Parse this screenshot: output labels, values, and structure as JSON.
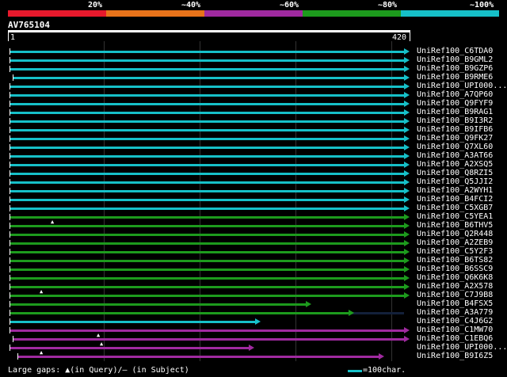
{
  "legend": {
    "labels": [
      "20%",
      "~40%",
      "~60%",
      "~80%",
      "~100%"
    ],
    "colors": [
      "#e8192c",
      "#e8731a",
      "#a02aa0",
      "#1d9b1d",
      "#16c0c8"
    ]
  },
  "query": {
    "name": "AV765104",
    "start": "1",
    "end": "420"
  },
  "hits": [
    {
      "label": "UniRef100_C6TDA0",
      "color": "#16c0c8"
    },
    {
      "label": "UniRef100_B9GML2",
      "color": "#16c0c8"
    },
    {
      "label": "UniRef100_B9GZP6",
      "color": "#16c0c8"
    },
    {
      "label": "UniRef100_B9RME6",
      "color": "#16c0c8"
    },
    {
      "label": "UniRef100_UPI000...",
      "color": "#16c0c8"
    },
    {
      "label": "UniRef100_A7QP60",
      "color": "#16c0c8"
    },
    {
      "label": "UniRef100_Q9FYF9",
      "color": "#16c0c8"
    },
    {
      "label": "UniRef100_B9RAG1",
      "color": "#16c0c8"
    },
    {
      "label": "UniRef100_B9I3R2",
      "color": "#16c0c8"
    },
    {
      "label": "UniRef100_B9IFB6",
      "color": "#16c0c8"
    },
    {
      "label": "UniRef100_Q9FK27",
      "color": "#16c0c8"
    },
    {
      "label": "UniRef100_Q7XL60",
      "color": "#16c0c8"
    },
    {
      "label": "UniRef100_A3AT66",
      "color": "#16c0c8"
    },
    {
      "label": "UniRef100_A2XSQ5",
      "color": "#16c0c8"
    },
    {
      "label": "UniRef100_Q8RZI5",
      "color": "#16c0c8"
    },
    {
      "label": "UniRef100_Q5JJI2",
      "color": "#16c0c8"
    },
    {
      "label": "UniRef100_A2WYH1",
      "color": "#16c0c8"
    },
    {
      "label": "UniRef100_B4FCI2",
      "color": "#16c0c8"
    },
    {
      "label": "UniRef100_C5XGB7",
      "color": "#16c0c8"
    },
    {
      "label": "UniRef100_C5YEA1",
      "color": "#1d9b1d"
    },
    {
      "label": "UniRef100_B6THV5",
      "color": "#1d9b1d"
    },
    {
      "label": "UniRef100_Q2R448",
      "color": "#1d9b1d"
    },
    {
      "label": "UniRef100_A2ZEB9",
      "color": "#1d9b1d"
    },
    {
      "label": "UniRef100_C5Y2F3",
      "color": "#1d9b1d"
    },
    {
      "label": "UniRef100_B6TS82",
      "color": "#1d9b1d"
    },
    {
      "label": "UniRef100_B6SSC9",
      "color": "#1d9b1d"
    },
    {
      "label": "UniRef100_Q6K6K8",
      "color": "#1d9b1d"
    },
    {
      "label": "UniRef100_A2X578",
      "color": "#1d9b1d"
    },
    {
      "label": "UniRef100_C7J9B8",
      "color": "#1d9b1d"
    },
    {
      "label": "UniRef100_B4FSX5",
      "color": "#1d9b1d"
    },
    {
      "label": "UniRef100_A3A779",
      "color": "#1d9b1d"
    },
    {
      "label": "UniRef100_C4J6G2",
      "color": "#16c0c8"
    },
    {
      "label": "UniRef100_C1MW70",
      "color": "#a02aa0"
    },
    {
      "label": "UniRef100_C1EBQ6",
      "color": "#a02aa0"
    },
    {
      "label": "UniRef100_UPI000...",
      "color": "#a02aa0"
    },
    {
      "label": "UniRef100_B9I6Z5",
      "color": "#a02aa0"
    }
  ],
  "footer": {
    "gaps_text": "Large gaps: ▲(in Query)/– (in Subject)",
    "scale_text": "=100char."
  }
}
